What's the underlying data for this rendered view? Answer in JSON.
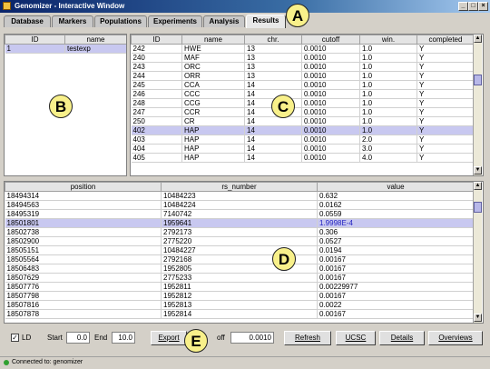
{
  "window": {
    "title": "Genomizer - Interactive Window"
  },
  "tabs": [
    "Database",
    "Markers",
    "Populations",
    "Experiments",
    "Analysis",
    "Results"
  ],
  "active_tab": "Results",
  "experiments": {
    "columns": [
      "ID",
      "name"
    ],
    "rows": [
      [
        "1",
        "testexp"
      ]
    ]
  },
  "results": {
    "columns": [
      "ID",
      "name",
      "chr.",
      "cutoff",
      "win.",
      "completed"
    ],
    "rows": [
      [
        "242",
        "HWE",
        "13",
        "0.0010",
        "1.0",
        "Y"
      ],
      [
        "240",
        "MAF",
        "13",
        "0.0010",
        "1.0",
        "Y"
      ],
      [
        "243",
        "ORC",
        "13",
        "0.0010",
        "1.0",
        "Y"
      ],
      [
        "244",
        "ORR",
        "13",
        "0.0010",
        "1.0",
        "Y"
      ],
      [
        "245",
        "CCA",
        "14",
        "0.0010",
        "1.0",
        "Y"
      ],
      [
        "246",
        "CCC",
        "14",
        "0.0010",
        "1.0",
        "Y"
      ],
      [
        "248",
        "CCG",
        "14",
        "0.0010",
        "1.0",
        "Y"
      ],
      [
        "247",
        "CCR",
        "14",
        "0.0010",
        "1.0",
        "Y"
      ],
      [
        "250",
        "CR",
        "14",
        "0.0010",
        "1.0",
        "Y"
      ],
      [
        "402",
        "HAP",
        "14",
        "0.0010",
        "1.0",
        "Y"
      ],
      [
        "403",
        "HAP",
        "14",
        "0.0010",
        "2.0",
        "Y"
      ],
      [
        "404",
        "HAP",
        "14",
        "0.0010",
        "3.0",
        "Y"
      ],
      [
        "405",
        "HAP",
        "14",
        "0.0010",
        "4.0",
        "Y"
      ]
    ],
    "selected_row": 9
  },
  "markers": {
    "columns": [
      "position",
      "rs_number",
      "value"
    ],
    "rows": [
      [
        "18494314",
        "10484223",
        "0.632"
      ],
      [
        "18494563",
        "10484224",
        "0.0162"
      ],
      [
        "18495319",
        "7140742",
        "0.0559"
      ],
      [
        "18501801",
        "1959641",
        "1.9998E-4"
      ],
      [
        "18502738",
        "2792173",
        "0.306"
      ],
      [
        "18502900",
        "2775220",
        "0.0527"
      ],
      [
        "18505151",
        "10484227",
        "0.0194"
      ],
      [
        "18505564",
        "2792168",
        "0.00167"
      ],
      [
        "18506483",
        "1952805",
        "0.00167"
      ],
      [
        "18507629",
        "2775233",
        "0.00167"
      ],
      [
        "18507776",
        "1952811",
        "0.00229977"
      ],
      [
        "18507798",
        "1952812",
        "0.00167"
      ],
      [
        "18507816",
        "1952813",
        "0.0022"
      ],
      [
        "18507878",
        "1952814",
        "0.00167"
      ]
    ],
    "selected_row": 3
  },
  "controls": {
    "ld_label": "LD",
    "ld_checked": true,
    "start_label": "Start",
    "start_value": "0.0",
    "end_label": "End",
    "end_value": "10.0",
    "export_label": "Export",
    "cutoff_label": "off",
    "cutoff_value": "0.0010",
    "refresh_label": "Refresh",
    "ucsc_label": "UCSC",
    "details_label": "Details",
    "overviews_label": "Overviews"
  },
  "status": {
    "text": "Connected to: genomizer"
  },
  "callouts": [
    "A",
    "B",
    "C",
    "D",
    "E"
  ],
  "colors": {
    "selection": "#c8c8f0",
    "callout_fill": "#f8f08a",
    "titlebar": "#0a246a"
  }
}
